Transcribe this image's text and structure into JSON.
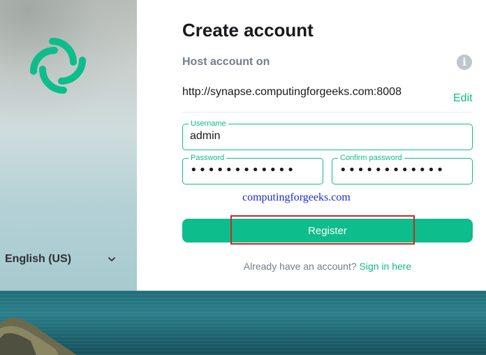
{
  "colors": {
    "accent": "#0dbd8b",
    "text_primary": "#17191c",
    "text_secondary": "#737d8c",
    "highlight": "#c82828",
    "watermark": "#1f2bd1"
  },
  "left_panel": {
    "logo_icon": "element-logo-icon",
    "language": {
      "label": "English (US)",
      "icon": "chevron-down-icon"
    }
  },
  "form": {
    "title": "Create account",
    "host_label": "Host account on",
    "info_icon": "info-icon",
    "info_glyph": "i",
    "server_url": "http://synapse.computingforgeeks.com:8008",
    "edit_label": "Edit",
    "username": {
      "label": "Username",
      "value": "admin"
    },
    "password": {
      "label": "Password",
      "masked_value": "••••••••••••"
    },
    "confirm_password": {
      "label": "Confirm password",
      "masked_value": "••••••••••••"
    },
    "watermark_text": "computingforgeeks.com",
    "register_label": "Register",
    "signin_prompt": "Already have an account?",
    "signin_link": "Sign in here"
  }
}
